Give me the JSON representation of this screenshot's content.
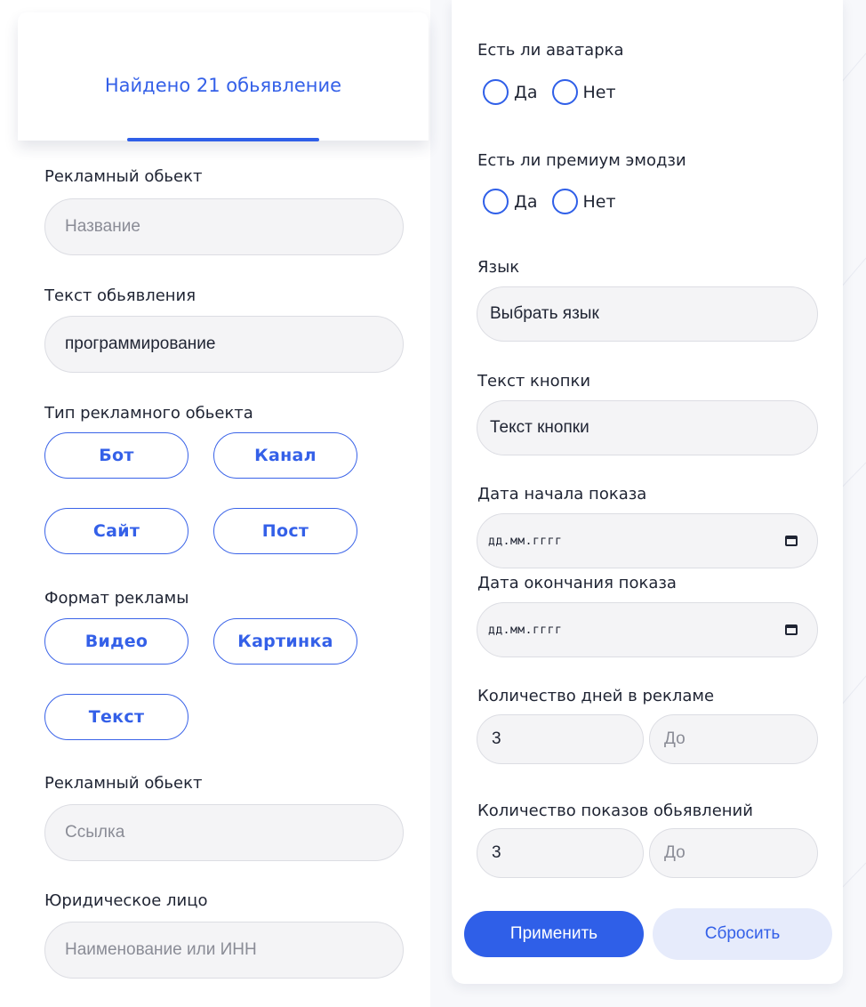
{
  "header": {
    "title": "Найдено 21 обьявление"
  },
  "left": {
    "ad_object": {
      "label": "Рекламный обьект",
      "placeholder": "Название"
    },
    "ad_text": {
      "label": "Текст обьявления",
      "value": "программирование"
    },
    "object_type": {
      "label": "Тип рекламного обьекта",
      "options": [
        "Бот",
        "Канал",
        "Сайт",
        "Пост"
      ]
    },
    "ad_format": {
      "label": "Формат рекламы",
      "options": [
        "Видео",
        "Картинка",
        "Текст"
      ]
    },
    "ad_link": {
      "label": "Рекламный обьект",
      "placeholder": "Ссылка"
    },
    "legal_entity": {
      "label": "Юридическое лицо",
      "placeholder": "Наименование или ИНН"
    }
  },
  "right": {
    "avatar": {
      "label": "Есть ли аватарка",
      "yes": "Да",
      "no": "Нет"
    },
    "premium_emoji": {
      "label": "Есть ли премиум эмодзи",
      "yes": "Да",
      "no": "Нет"
    },
    "language": {
      "label": "Язык",
      "value": "Выбрать язык"
    },
    "button_text": {
      "label": "Текст кнопки",
      "value": "Текст кнопки"
    },
    "start_date": {
      "label": "Дата начала показа",
      "value": "дд.мм.гггг"
    },
    "end_date": {
      "label": "Дата окончания показа",
      "value": "дд.мм.гггг"
    },
    "days": {
      "label": "Количество дней в рекламе",
      "from": "3",
      "to_placeholder": "До"
    },
    "views": {
      "label": "Количество показов обьявлений",
      "from": "3",
      "to_placeholder": "До"
    },
    "apply": "Применить",
    "reset": "Сбросить"
  },
  "colors": {
    "accent": "#2f5fe8",
    "accent_text": "#3460e8",
    "field_bg": "#f4f4f6",
    "reset_bg": "#e6ebfb"
  }
}
